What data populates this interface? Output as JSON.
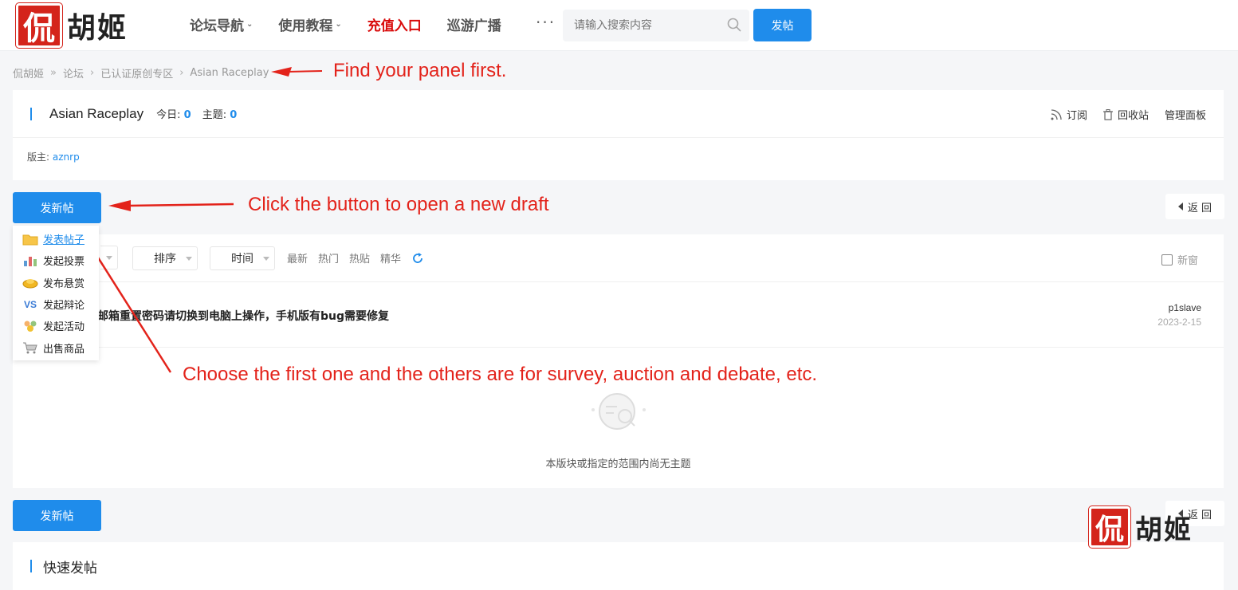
{
  "header": {
    "logo_seal": "侃",
    "logo_text": "胡姬",
    "nav": [
      {
        "label": "论坛导航",
        "dropdown": true,
        "red": false
      },
      {
        "label": "使用教程",
        "dropdown": true,
        "red": false
      },
      {
        "label": "充值入口",
        "dropdown": false,
        "red": true
      },
      {
        "label": "巡游广播",
        "dropdown": false,
        "red": false
      }
    ],
    "more": "···",
    "search_placeholder": "请输入搜索内容",
    "post_button": "发帖"
  },
  "breadcrumb": {
    "items": [
      "侃胡姬",
      "论坛",
      "已认证原创专区",
      "Asian Raceplay"
    ],
    "seps": [
      "»",
      "›",
      "›"
    ]
  },
  "forum": {
    "name": "Asian Raceplay",
    "today_label": "今日:",
    "today_value": "0",
    "topics_label": "主题:",
    "topics_value": "0",
    "actions": {
      "subscribe": "订阅",
      "recycle": "回收站",
      "manage": "管理面板"
    },
    "moderator_label": "版主:",
    "moderator": "aznrp"
  },
  "new_post_button": "发新帖",
  "back_button": "返 回",
  "dropdown": [
    {
      "label": "发表帖子",
      "icon": "folder-icon"
    },
    {
      "label": "发起投票",
      "icon": "poll-chart-icon"
    },
    {
      "label": "发布悬赏",
      "icon": "gold-ingot-icon"
    },
    {
      "label": "发起辩论",
      "icon": "vs-icon"
    },
    {
      "label": "发起活动",
      "icon": "people-icon"
    },
    {
      "label": "出售商品",
      "icon": "cart-icon"
    }
  ],
  "filters": {
    "sort": "排序",
    "time": "时间",
    "links": [
      "最新",
      "热门",
      "热贴",
      "精华"
    ],
    "new_window": "新窗"
  },
  "thread": {
    "title": "邮箱重置密码请切换到电脑上操作，手机版有bug需要修复",
    "author": "p1slave",
    "date": "2023-2-15"
  },
  "empty_text": "本版块或指定的范围内尚无主题",
  "quick_post": "快速发帖",
  "annotations": {
    "a1": "Find your panel first.",
    "a2": "Click the button to open a new draft",
    "a3": "Choose the first one and the others are for survey, auction and debate, etc."
  },
  "colors": {
    "accent": "#1f8ceb",
    "annotation": "#e3231b",
    "brand_red": "#d4241b"
  }
}
